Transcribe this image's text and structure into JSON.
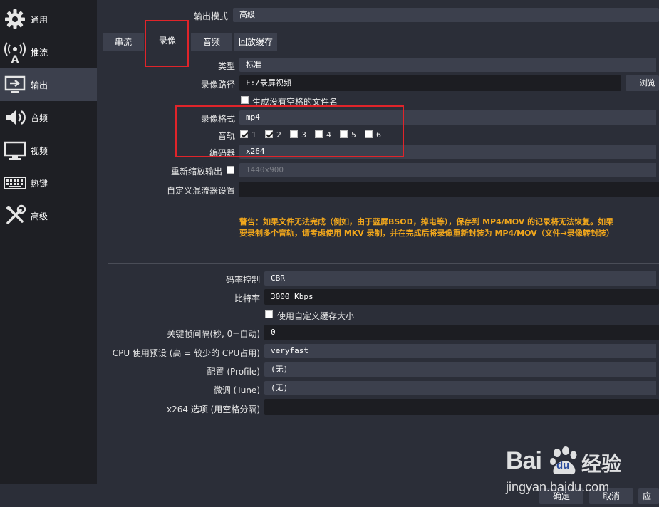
{
  "sidebar": {
    "items": [
      {
        "label": "通用",
        "icon": "gear-icon"
      },
      {
        "label": "推流",
        "icon": "broadcast-icon"
      },
      {
        "label": "输出",
        "icon": "output-monitor-icon",
        "active": true
      },
      {
        "label": "音频",
        "icon": "speaker-icon"
      },
      {
        "label": "视频",
        "icon": "monitor-icon"
      },
      {
        "label": "热键",
        "icon": "keyboard-icon"
      },
      {
        "label": "高级",
        "icon": "tools-icon"
      }
    ]
  },
  "output_mode": {
    "label": "输出模式",
    "value": "高级"
  },
  "tabs": [
    {
      "label": "串流"
    },
    {
      "label": "录像",
      "active": true
    },
    {
      "label": "音频"
    },
    {
      "label": "回放缓存"
    }
  ],
  "recording": {
    "type_label": "类型",
    "type_value": "标准",
    "path_label": "录像路径",
    "path_value": "F:/录屏视频",
    "browse_label": "浏览",
    "no_space_label": "生成没有空格的文件名",
    "format_label": "录像格式",
    "format_value": "mp4",
    "tracks_label": "音轨",
    "tracks": [
      {
        "label": "1",
        "checked": true
      },
      {
        "label": "2",
        "checked": true
      },
      {
        "label": "3",
        "checked": false
      },
      {
        "label": "4",
        "checked": false
      },
      {
        "label": "5",
        "checked": false
      },
      {
        "label": "6",
        "checked": false
      }
    ],
    "encoder_label": "编码器",
    "encoder_value": "x264",
    "rescale_label": "重新缩放输出",
    "rescale_value": "1440x900",
    "muxer_label": "自定义混流器设置",
    "muxer_value": "",
    "warning_line1": "警告：如果文件无法完成（例如，由于蓝屏BSOD，掉电等），保存到 MP4/MOV 的记录将无法恢复。如果",
    "warning_line2": "要录制多个音轨，请考虑使用 MKV 录制，并在完成后将录像重新封装为 MP4/MOV（文件→录像转封装）"
  },
  "encoder_settings": {
    "rate_control_label": "码率控制",
    "rate_control_value": "CBR",
    "bitrate_label": "比特率",
    "bitrate_value": "3000 Kbps",
    "custom_buffer_label": "使用自定义缓存大小",
    "keyframe_label": "关键帧间隔(秒, 0=自动)",
    "keyframe_value": "0",
    "preset_label": "CPU 使用预设 (高 = 较少的 CPU占用)",
    "preset_value": "veryfast",
    "profile_label": "配置 (Profile)",
    "profile_value": "(无)",
    "tune_label": "微调 (Tune)",
    "tune_value": "(无)",
    "x264_opts_label": "x264 选项 (用空格分隔)",
    "x264_opts_value": ""
  },
  "footer": {
    "ok_label": "确定",
    "cancel_label": "取消",
    "apply_label": "应"
  },
  "watermark": {
    "brand": "Bai",
    "du": "du",
    "jingyan": "经验",
    "url": "jingyan.baidu.com"
  },
  "colors": {
    "accent_red": "#e0242a",
    "warning": "#f0a61c",
    "sidebar_active": "#3c404d"
  }
}
